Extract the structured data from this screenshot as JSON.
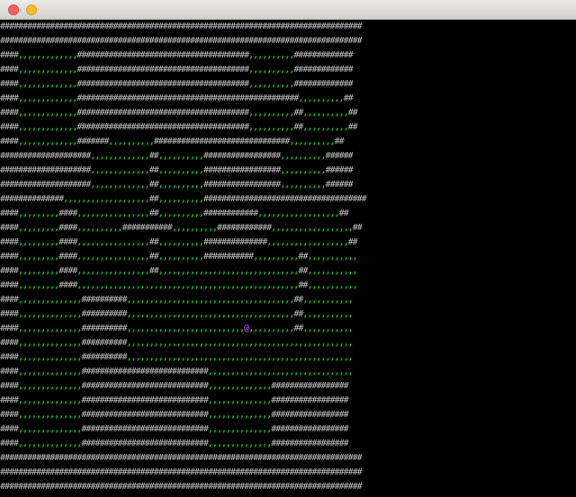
{
  "window": {
    "title": ""
  },
  "game": {
    "map_rows": [
      "################################################################################",
      "################################################################################",
      "####,,,,,,,,,,,,,######################################,,,,,,,,,,#############",
      "####,,,,,,,,,,,,,######################################,,,,,,,,,,#############",
      "####,,,,,,,,,,,,,######################################,,,,,,,,,,#############",
      "####,,,,,,,,,,,,,#################################################,,,,,,,,,,##",
      "####,,,,,,,,,,,,,######################################,,,,,,,,,,##,,,,,,,,,,##",
      "####,,,,,,,,,,,,,######################################,,,,,,,,,,##,,,,,,,,,,##",
      "####,,,,,,,,,,,,,#######,,,,,,,,,,##############################,,,,,,,,,,##",
      "####################,,,,,,,,,,,,,##,,,,,,,,,,#################,,,,,,,,,,######",
      "####################,,,,,,,,,,,,,##,,,,,,,,,,#################,,,,,,,,,,######",
      "####################,,,,,,,,,,,,,##,,,,,,,,,,#################,,,,,,,,,,######",
      "##############,,,,,,,,,,,,,,,,,,,##,,,,,,,,,,####################################",
      "####,,,,,,,,,####,,,,,,,,,,,,,,,,##,,,,,,,,,,############,,,,,,,,,,,,,,,,,,##",
      "####,,,,,,,,,####,,,,,,,,,,###########,,,,,,,,,,############,,,,,,,,,,,,,,,,,,##",
      "####,,,,,,,,,####,,,,,,,,,,,,,,,,##,,,,,,,,,,##############,,,,,,,,,,,,,,,,,,##",
      "####,,,,,,,,,####,,,,,,,,,,,,,,,,##,,,,,,,,,,###########,,,,,,,,,,##,,,,,,,,,,,",
      "####,,,,,,,,,####,,,,,,,,,,,,,,,,##,,,,,,,,,,,,,,,,,,,,,,,,,,,,,,,##,,,,,,,,,,,",
      "####,,,,,,,,,####,,,,,,,,,,,,,,,,,,,,,,,,,,,,,,,,,,,,,,,,,,,,,,,,,##,,,,,,,,,,,",
      "####,,,,,,,,,,,,,,##########,,,,,,,,,,,,,,,,,,,,,,,,,,,,,,,,,,,,,##,,,,,,,,,,,",
      "####,,,,,,,,,,,,,,##########,,,,,,,,,,,,,,,,,,,,,,,,,,,,,,,,,,,,,##,,,,,,,,,,,",
      "####,,,,,,,,,,,,,,##########,,,,,,,,,,,,,,,,,,,,,,,,,,@,,,,,,,,,,##,,,,,,,,,,,",
      "####,,,,,,,,,,,,,,##########,,,,,,,,,,,,,,,,,,,,,,,,,,,,,,,,,,,,,,,,,,,,,,,,,,",
      "####,,,,,,,,,,,,,,##########,,,,,,,,,,,,,,,,,,,,,,,,,,,,,,,,,,,,,,,,,,,,,,,,,,",
      "####,,,,,,,,,,,,,,############################,,,,,,,,,,,,,,,,,,,,,,,,,,,,,,,,",
      "####,,,,,,,,,,,,,,############################,,,,,,,,,,,,,,#################",
      "####,,,,,,,,,,,,,,############################,,,,,,,,,,,,,,#################",
      "####,,,,,,,,,,,,,,############################,,,,,,,,,,,,,,#################",
      "####,,,,,,,,,,,,,,############################,,,,,,,,,,,,,,#################",
      "####,,,,,,,,,,,,,,############################,,,,,,,,,,,,,,#################",
      "################################################################################",
      "################################################################################",
      "################################################################################"
    ],
    "player_glyph": "@"
  }
}
